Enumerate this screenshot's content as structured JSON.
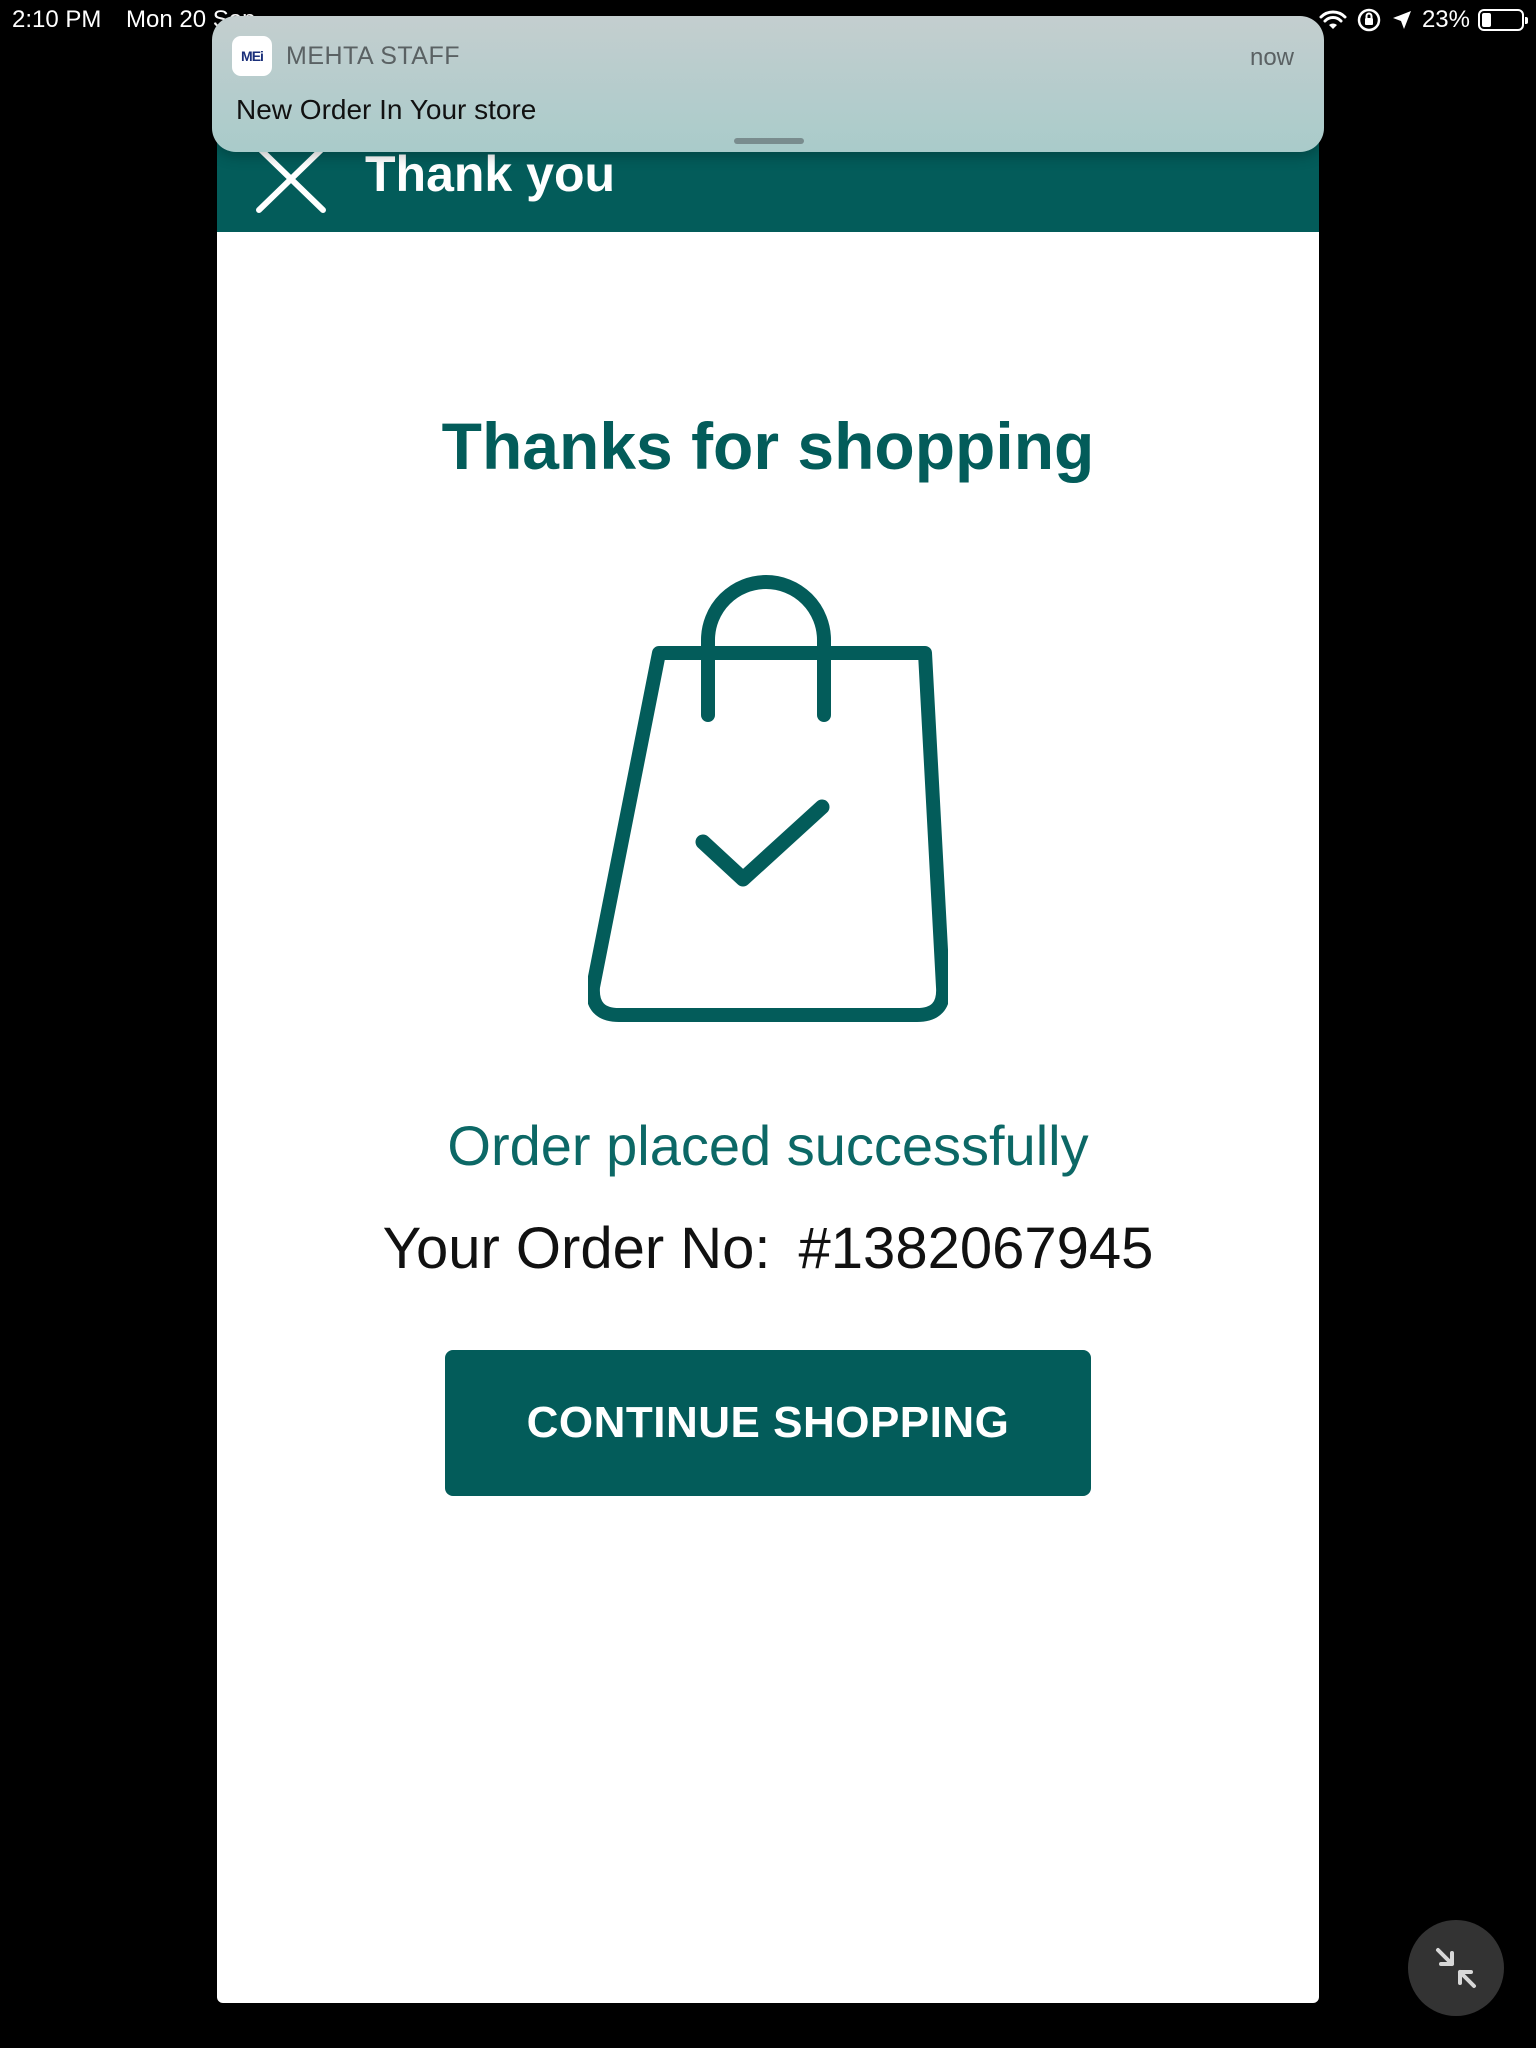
{
  "status_bar": {
    "time": "2:10 PM",
    "date": "Mon 20 Sep",
    "battery_percent": "23%",
    "battery_level": 0.23,
    "icons": [
      "wifi-icon",
      "orientation-lock-icon",
      "location-icon",
      "battery-icon"
    ]
  },
  "notification": {
    "app_name": "MEHTA STAFF",
    "time": "now",
    "message": "New Order In Your store",
    "app_icon_text": "MEi"
  },
  "header": {
    "title": "Thank you",
    "close_icon": "close-icon"
  },
  "main": {
    "heading": "Thanks for shopping",
    "illustration": "shopping-bag-check-icon",
    "success_message": "Order placed successfully",
    "order_label": "Your Order No:",
    "order_number": "#1382067945",
    "continue_button": "CONTINUE SHOPPING"
  },
  "floating_button": {
    "icon": "minimize-arrows-icon"
  },
  "colors": {
    "brand": "#035c5a",
    "success_text": "#0c6866",
    "background": "#000000",
    "surface": "#ffffff"
  }
}
